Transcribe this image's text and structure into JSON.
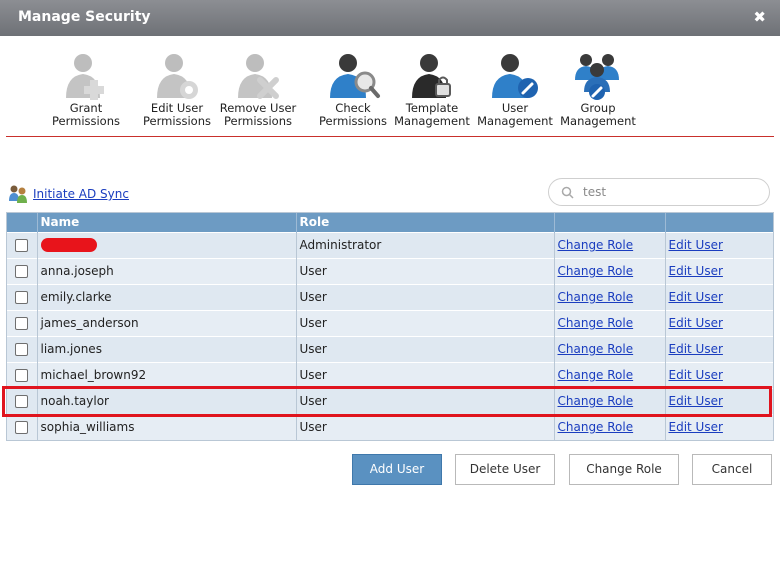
{
  "window": {
    "title": "Manage Security",
    "close_glyph": "✖"
  },
  "toolbar": [
    {
      "label": "Grant\nPermissions",
      "icon": "grant-permissions-icon"
    },
    {
      "label": "Edit User\nPermissions",
      "icon": "edit-user-permissions-icon"
    },
    {
      "label": "Remove User\nPermissions",
      "icon": "remove-user-permissions-icon"
    },
    {
      "label": "Check\nPermissions",
      "icon": "check-permissions-icon"
    },
    {
      "label": "Template\nManagement",
      "icon": "template-management-icon"
    },
    {
      "label": "User\nManagement",
      "icon": "user-management-icon"
    },
    {
      "label": "Group\nManagement",
      "icon": "group-management-icon"
    }
  ],
  "ad_sync": {
    "label": "Initiate AD Sync",
    "icon": "ad-sync-icon"
  },
  "search": {
    "value": "test",
    "icon": "search-icon"
  },
  "table": {
    "headers": [
      "Name",
      "Role",
      "",
      ""
    ],
    "rows": [
      {
        "name": "",
        "name_redacted": true,
        "role": "Administrator",
        "change_role": "Change Role",
        "edit_user": "Edit User"
      },
      {
        "name": "anna.joseph",
        "role": "User",
        "change_role": "Change Role",
        "edit_user": "Edit User"
      },
      {
        "name": "emily.clarke",
        "role": "User",
        "change_role": "Change Role",
        "edit_user": "Edit User"
      },
      {
        "name": "james_anderson",
        "role": "User",
        "change_role": "Change Role",
        "edit_user": "Edit User"
      },
      {
        "name": "liam.jones",
        "role": "User",
        "change_role": "Change Role",
        "edit_user": "Edit User"
      },
      {
        "name": "michael_brown92",
        "role": "User",
        "change_role": "Change Role",
        "edit_user": "Edit User"
      },
      {
        "name": "noah.taylor",
        "role": "User",
        "change_role": "Change Role",
        "edit_user": "Edit User",
        "highlighted": true
      },
      {
        "name": "sophia_williams",
        "role": "User",
        "change_role": "Change Role",
        "edit_user": "Edit User"
      }
    ]
  },
  "actions": {
    "add_user": "Add User",
    "delete_user": "Delete User",
    "change_role": "Change Role",
    "cancel": "Cancel"
  },
  "colors": {
    "header": "#6d9bc3",
    "highlight": "#e0141e",
    "primary_button": "#5a91c1",
    "link": "#1a3dbf"
  }
}
